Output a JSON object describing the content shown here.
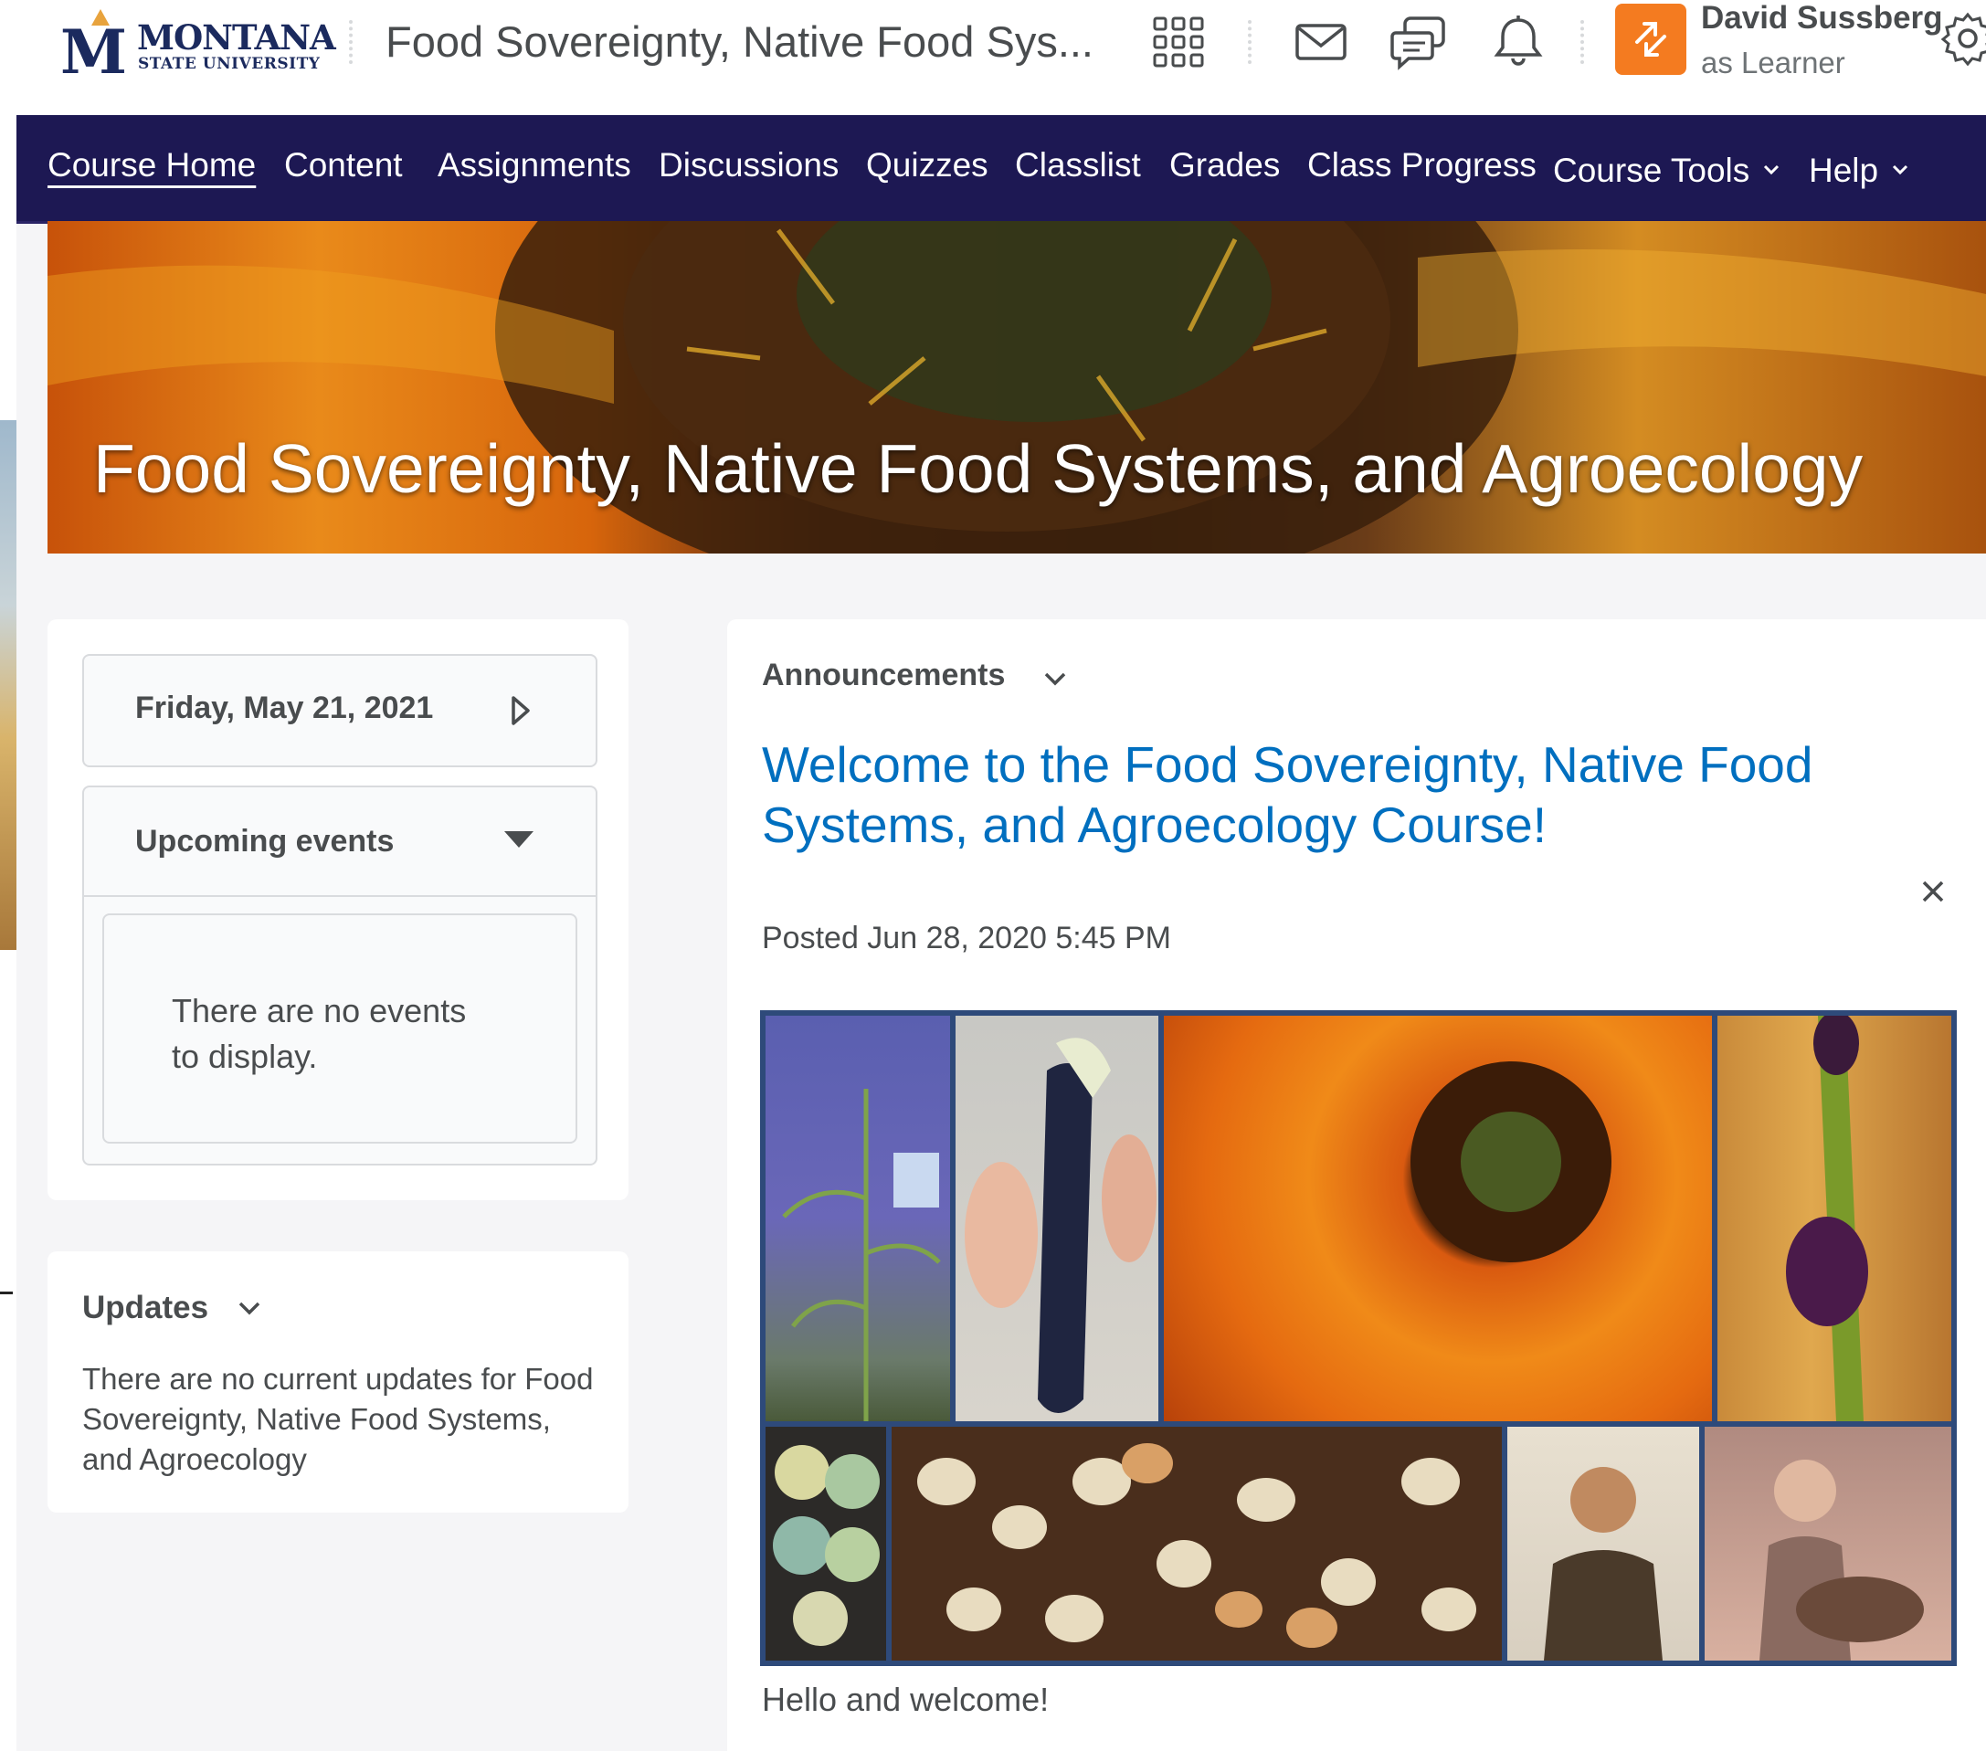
{
  "header": {
    "logo": {
      "name": "MONTANA",
      "sub": "STATE UNIVERSITY",
      "letter": "M"
    },
    "course_title": "Food Sovereignty, Native Food Sys...",
    "user": {
      "name": "David Sussberg",
      "role": "as Learner"
    }
  },
  "nav": {
    "items": [
      {
        "label": "Course Home"
      },
      {
        "label": "Content"
      },
      {
        "label": "Assignments"
      },
      {
        "label": "Discussions"
      },
      {
        "label": "Quizzes"
      },
      {
        "label": "Classlist"
      },
      {
        "label": "Grades"
      },
      {
        "label": "Class Progress"
      },
      {
        "label": "Course Tools"
      },
      {
        "label": "Help"
      }
    ]
  },
  "banner": {
    "title": "Food Sovereignty, Native Food Systems, and Agroecology"
  },
  "calendar": {
    "date": "Friday, May 21, 2021",
    "events_title": "Upcoming events",
    "empty_text": "There are no events to display."
  },
  "updates": {
    "title": "Updates",
    "text": "There are no current updates for Food Sovereignty, Native Food Systems, and Agroecology"
  },
  "announcements": {
    "heading": "Announcements",
    "title": "Welcome to the Food Sovereignty, Native Food Systems, and Agroecology Course!",
    "posted": "Posted Jun 28, 2020 5:45 PM",
    "body": "Hello and welcome!"
  },
  "colors": {
    "nav_bg": "#1d1853",
    "link_blue": "#006fbf",
    "switch_orange": "#f47b20",
    "brand_navy": "#1b2a5e"
  },
  "icons": [
    "app-grid-icon",
    "mail-icon",
    "chat-icon",
    "bell-icon",
    "role-switch-icon",
    "gear-icon",
    "chevron-down-icon",
    "play-right-icon",
    "caret-down-icon",
    "close-icon"
  ]
}
